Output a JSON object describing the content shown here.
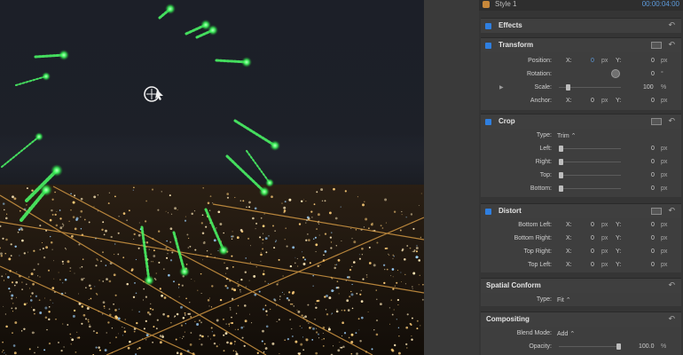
{
  "header": {
    "style_name": "Style 1",
    "timecode": "00:00:04:00",
    "style_color": "#c8883a"
  },
  "colors": {
    "accent": "#2f7fe0",
    "streak": "#4cff68"
  },
  "viewer": {
    "cursor_icon": "crosshair-icon"
  },
  "inspector": {
    "reset_glyph": "↶",
    "units": {
      "px": "px",
      "deg": "°",
      "pct": "%"
    },
    "effects": {
      "title": "Effects"
    },
    "transform": {
      "title": "Transform",
      "position": {
        "label": "Position:",
        "x_label": "X:",
        "x": "0",
        "y_label": "Y:",
        "y": "0"
      },
      "rotation": {
        "label": "Rotation:",
        "value": "0"
      },
      "scale": {
        "label": "Scale:",
        "value": "100",
        "level_pct": 12
      },
      "anchor": {
        "label": "Anchor:",
        "x_label": "X:",
        "x": "0",
        "y_label": "Y:",
        "y": "0"
      }
    },
    "crop": {
      "title": "Crop",
      "type": {
        "label": "Type:",
        "value": "Trim ⌃"
      },
      "left": {
        "label": "Left:",
        "value": "0"
      },
      "right": {
        "label": "Right:",
        "value": "0"
      },
      "top": {
        "label": "Top:",
        "value": "0"
      },
      "bottom": {
        "label": "Bottom:",
        "value": "0"
      }
    },
    "distort": {
      "title": "Distort",
      "bottom_left": {
        "label": "Bottom Left:",
        "x_label": "X:",
        "x": "0",
        "y_label": "Y:",
        "y": "0"
      },
      "bottom_right": {
        "label": "Bottom Right:",
        "x_label": "X:",
        "x": "0",
        "y_label": "Y:",
        "y": "0"
      },
      "top_right": {
        "label": "Top Right:",
        "x_label": "X:",
        "x": "0",
        "y_label": "Y:",
        "y": "0"
      },
      "top_left": {
        "label": "Top Left:",
        "x_label": "X:",
        "x": "0",
        "y_label": "Y:",
        "y": "0"
      }
    },
    "spatial_conform": {
      "title": "Spatial Conform",
      "type": {
        "label": "Type:",
        "value": "Fit ⌃"
      }
    },
    "compositing": {
      "title": "Compositing",
      "blend_mode": {
        "label": "Blend Mode:",
        "value": "Add ⌃"
      },
      "opacity": {
        "label": "Opacity:",
        "value": "100.0",
        "level_pct": 100
      }
    }
  }
}
